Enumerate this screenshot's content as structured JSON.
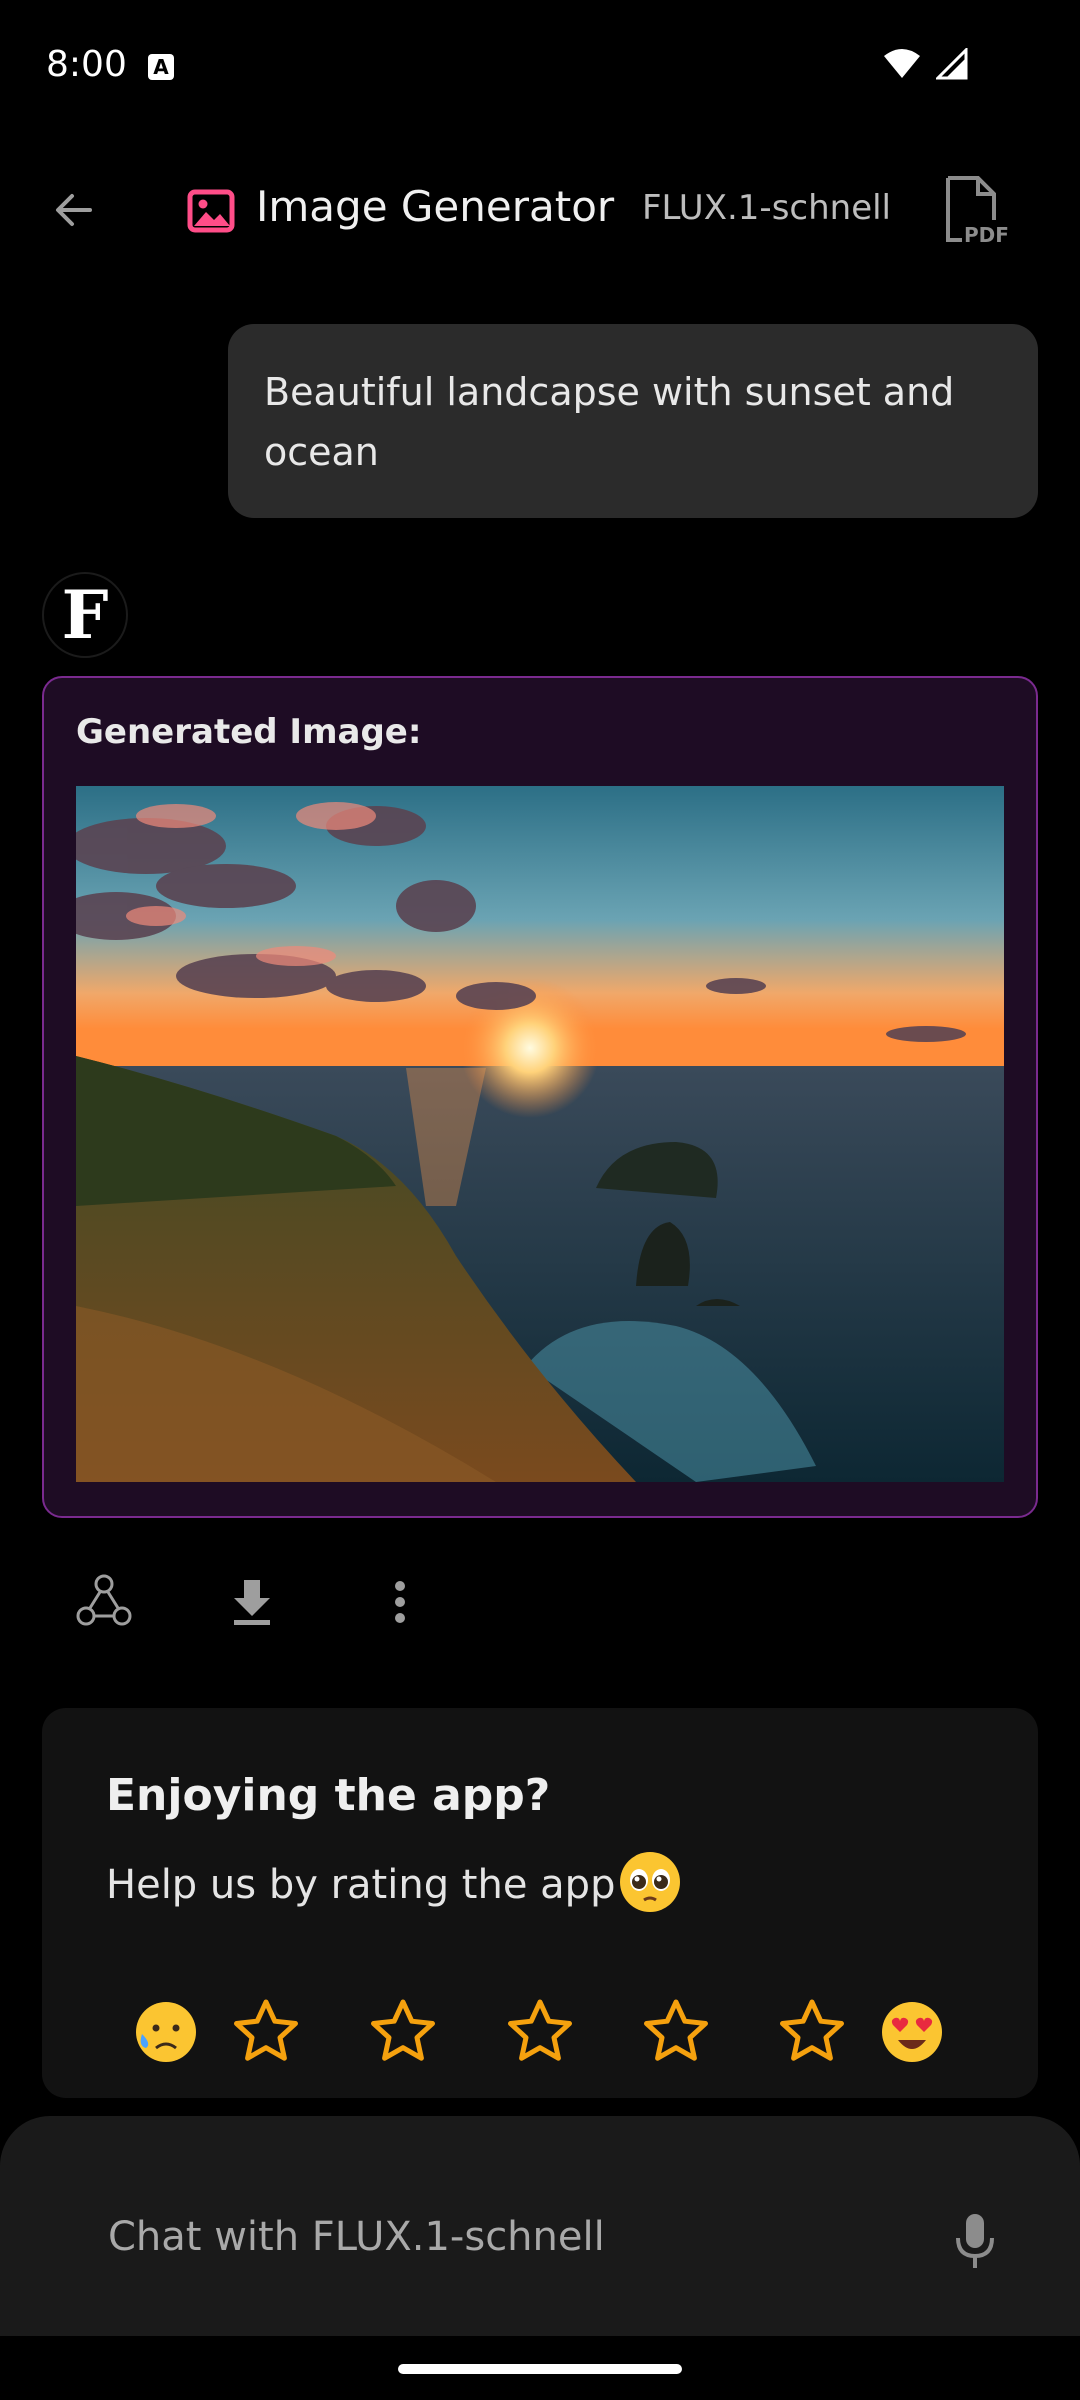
{
  "status": {
    "time": "8:00",
    "notification_glyph": "A"
  },
  "header": {
    "title": "Image Generator",
    "model": "FLUX.1-schnell",
    "icons": [
      "back-arrow-icon",
      "image-icon",
      "pdf-icon"
    ]
  },
  "user_message": {
    "text": "Beautiful landcapse with sunset and ocean"
  },
  "bot": {
    "avatar_letter": "F",
    "label": "Generated Image:"
  },
  "actions": [
    "share-icon",
    "download-icon",
    "more-vert-icon"
  ],
  "rating": {
    "title": "Enjoying the app?",
    "subtitle": "Help us by rating the app",
    "stars": 5,
    "selected_rating": 0
  },
  "chat": {
    "placeholder": "Chat with FLUX.1-schnell"
  },
  "colors": {
    "accent_pink": "#ff4d88",
    "card_border": "#7a2a8f",
    "card_bg": "#1e0c24",
    "star": "#f5a10e"
  }
}
